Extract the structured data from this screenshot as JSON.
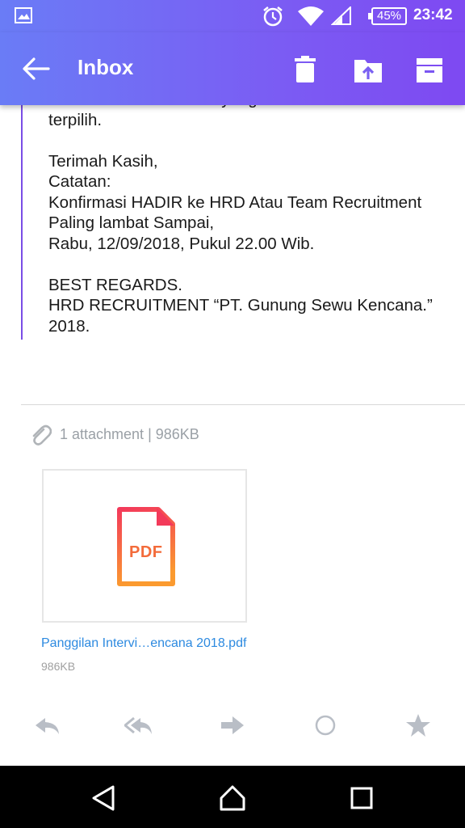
{
  "status_bar": {
    "battery": "45%",
    "time": "23:42"
  },
  "app_bar": {
    "title": "Inbox",
    "icons": [
      "back-arrow-icon",
      "trash-icon",
      "move-to-folder-icon",
      "archive-icon"
    ]
  },
  "message": {
    "lines": [
      "kirim ke email kandidat yang",
      "terpilih.",
      "",
      "Terimah Kasih,",
      "Catatan:",
      "Konfirmasi HADIR ke HRD Atau Team Recruitment",
      "Paling lambat Sampai,",
      "Rabu, 12/09/2018, Pukul 22.00 Wib.",
      "",
      "BEST REGARDS.",
      "HRD RECRUITMENT “PT. Gunung Sewu Kencana.”",
      "2018."
    ]
  },
  "attachments": {
    "summary": "1 attachment | 986KB",
    "file_type": "PDF",
    "file_name": "Panggilan Intervi…encana 2018.pdf",
    "file_size": "986KB"
  },
  "actions": [
    "reply-icon",
    "reply-all-icon",
    "forward-icon",
    "mark-circle-icon",
    "star-icon"
  ],
  "colors": {
    "accent": "#7b5cf3",
    "link": "#2d8ae0",
    "pdf": "#f36b3a"
  }
}
